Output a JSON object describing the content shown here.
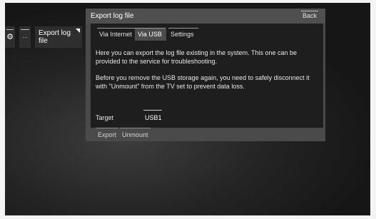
{
  "breadcrumb": {
    "settings_icon": "gear-icon",
    "more_label": "...",
    "current_label": "Export log file",
    "corner_icon": "corner-triangle-icon"
  },
  "dialog": {
    "title": "Export log file",
    "back_label": "Back",
    "tabs": [
      {
        "label": "Via Internet",
        "active": false
      },
      {
        "label": "Via USB",
        "active": true
      },
      {
        "label": "Settings",
        "active": false
      }
    ],
    "paragraph1": "Here you can export the log file existing in the system. This one can be provided to the service for troubleshooting.",
    "paragraph2": "Before you remove the USB storage again, you need to safely disconnect it with \"Unmount\" from the TV set to prevent data loss.",
    "target_label": "Target",
    "target_value": "USB1",
    "actions": [
      {
        "label": "Export"
      },
      {
        "label": "Unmount"
      }
    ]
  }
}
